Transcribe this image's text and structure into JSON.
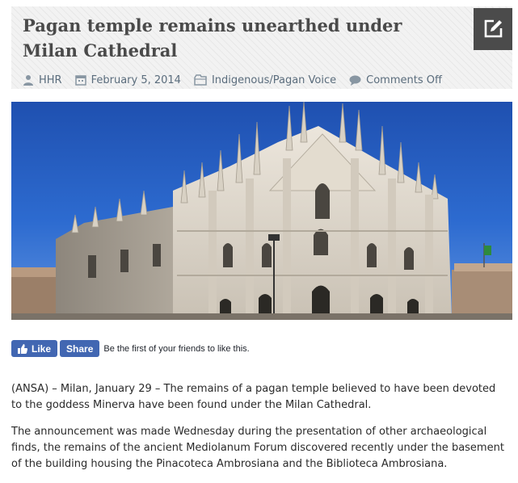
{
  "post": {
    "title": "Pagan temple remains unearthed under Milan Cathedral",
    "meta": {
      "author": "HHR",
      "date": "February 5, 2014",
      "category": "Indigenous/Pagan Voice",
      "comments": "Comments Off"
    },
    "hero_image": {
      "subject": "Milan Cathedral facade under blue sky",
      "colors": {
        "sky": "#2d6bd0",
        "marble": "#e9e3d8",
        "shadow": "#9d968b"
      }
    }
  },
  "social": {
    "like_label": "Like",
    "share_label": "Share",
    "note": "Be the first of your friends to like this.",
    "brand_color": "#4267b2"
  },
  "article": {
    "paragraphs": [
      "(ANSA) – Milan, January 29 – The remains of a pagan temple believed to have been devoted to the goddess Minerva have been found under the Milan Cathedral.",
      "The announcement was made Wednesday during the presentation of other archaeological finds, the remains of the ancient Mediolanum Forum discovered recently under the basement of the building housing the Pinacoteca Ambrosiana and the Biblioteca Ambrosiana."
    ]
  }
}
